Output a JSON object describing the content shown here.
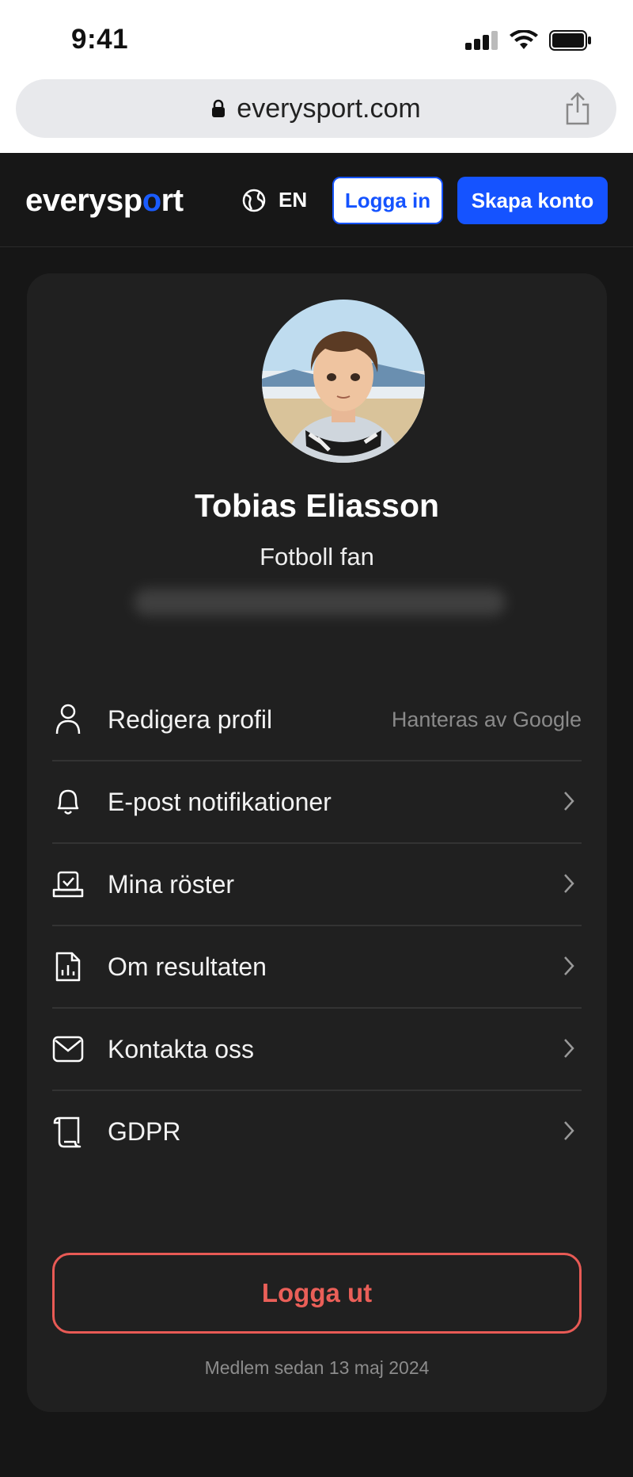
{
  "status_bar": {
    "time": "9:41"
  },
  "browser": {
    "url": "everysport.com"
  },
  "nav": {
    "logo_text_pre": "everysp",
    "logo_text_o": "o",
    "logo_text_post": "rt",
    "language": "EN",
    "login_label": "Logga in",
    "signup_label": "Skapa konto"
  },
  "profile": {
    "name": "Tobias Eliasson",
    "subtitle": "Fotboll fan"
  },
  "menu": {
    "items": [
      {
        "label": "Redigera profil",
        "right_text": "Hanteras av Google",
        "icon": "user-icon"
      },
      {
        "label": "E-post notifikationer",
        "icon": "bell-icon"
      },
      {
        "label": "Mina röster",
        "icon": "ballot-icon"
      },
      {
        "label": "Om resultaten",
        "icon": "chart-document-icon"
      },
      {
        "label": "Kontakta oss",
        "icon": "mail-icon"
      },
      {
        "label": "GDPR",
        "icon": "scroll-icon"
      }
    ]
  },
  "logout_label": "Logga ut",
  "member_since": "Medlem sedan 13 maj 2024",
  "colors": {
    "accent_blue": "#1553ff",
    "logout_red": "#ea5f58",
    "background": "#161616",
    "card": "#202020"
  }
}
